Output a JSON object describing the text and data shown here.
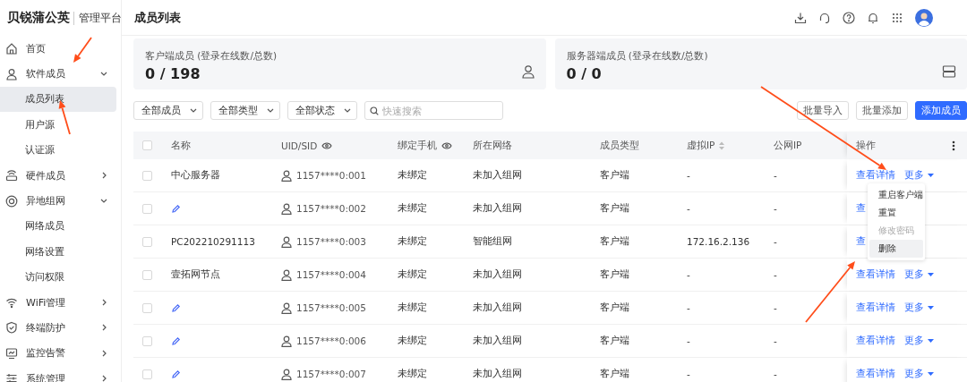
{
  "logo": {
    "brand": "贝锐蒲公英",
    "product": "管理平台"
  },
  "sidebar": {
    "items": [
      {
        "label": "首页",
        "selected": false
      },
      {
        "label": "软件成员",
        "selected": false,
        "expanded": true,
        "children": [
          {
            "label": "成员列表",
            "selected": true
          },
          {
            "label": "用户源",
            "selected": false
          },
          {
            "label": "认证源",
            "selected": false
          }
        ]
      },
      {
        "label": "硬件成员",
        "selected": false,
        "expanded": false
      },
      {
        "label": "异地组网",
        "selected": false,
        "expanded": true,
        "children": [
          {
            "label": "网络成员",
            "selected": false
          },
          {
            "label": "网络设置",
            "selected": false
          },
          {
            "label": "访问权限",
            "selected": false
          }
        ]
      },
      {
        "label": "WiFi管理",
        "selected": false,
        "expanded": false
      },
      {
        "label": "终端防护",
        "selected": false,
        "expanded": false
      },
      {
        "label": "监控告警",
        "selected": false,
        "expanded": false
      },
      {
        "label": "系统管理",
        "selected": false,
        "expanded": false
      }
    ]
  },
  "page_title": "成员列表",
  "stats": [
    {
      "label": "客户端成员 (登录在线数/总数)",
      "value": "0 / 198"
    },
    {
      "label": "服务器端成员 (登录在线数/总数)",
      "value": "0 / 0"
    }
  ],
  "filters": [
    "全部成员",
    "全部类型",
    "全部状态"
  ],
  "search": {
    "placeholder": "快速搜索"
  },
  "buttons": [
    {
      "label": "批量导入",
      "primary": false
    },
    {
      "label": "批量添加",
      "primary": false
    },
    {
      "label": "添加成员",
      "primary": true
    }
  ],
  "table": {
    "all_checked": false,
    "columns": [
      "名称",
      "UID/SID",
      "绑定手机",
      "所在网络",
      "成员类型",
      "虚拟IP",
      "公网IP",
      "操作"
    ],
    "rows": [
      {
        "checked": false,
        "kind": "named",
        "name": "中心服务器",
        "uid": "1157****0:001",
        "phone": "未绑定",
        "network": "未加入组网",
        "type": "客户端",
        "virtual_ip": "-",
        "public_ip": "-",
        "actions": [
          {
            "label": "查看详情",
            "dropdown": false
          },
          {
            "label": "更多",
            "dropdown": true
          }
        ]
      },
      {
        "checked": false,
        "kind": "unnamed",
        "uid": "1157****0:002",
        "phone": "未绑定",
        "network": "未加入组网",
        "type": "客户端",
        "virtual_ip": "-",
        "public_ip": "-",
        "actions": [
          {
            "label": "查",
            "dropdown": false
          }
        ]
      },
      {
        "checked": false,
        "kind": "named",
        "name": "PC202210291113",
        "uid": "1157****0:003",
        "phone": "未绑定",
        "network": "智能组网",
        "type": "客户端",
        "virtual_ip": "172.16.2.136",
        "public_ip": "-",
        "actions": [
          {
            "label": "查",
            "dropdown": false
          }
        ]
      },
      {
        "checked": false,
        "kind": "named",
        "name": "壹拓网节点",
        "uid": "1157****0:004",
        "phone": "未绑定",
        "network": "未加入组网",
        "type": "客户端",
        "virtual_ip": "-",
        "public_ip": "-",
        "actions": [
          {
            "label": "查看详情",
            "dropdown": false
          },
          {
            "label": "更多",
            "dropdown": true
          }
        ]
      },
      {
        "checked": false,
        "kind": "unnamed",
        "uid": "1157****0:005",
        "phone": "未绑定",
        "network": "未加入组网",
        "type": "客户端",
        "virtual_ip": "-",
        "public_ip": "-",
        "actions": [
          {
            "label": "查看详情",
            "dropdown": false
          },
          {
            "label": "更多",
            "dropdown": true
          }
        ]
      },
      {
        "checked": false,
        "kind": "unnamed",
        "uid": "1157****0:006",
        "phone": "未绑定",
        "network": "未加入组网",
        "type": "客户端",
        "virtual_ip": "-",
        "public_ip": "-",
        "actions": [
          {
            "label": "查看详情",
            "dropdown": false
          },
          {
            "label": "更多",
            "dropdown": true
          }
        ]
      },
      {
        "checked": false,
        "kind": "unnamed",
        "uid": "1157****0:007",
        "phone": "未绑定",
        "network": "未加入组网",
        "type": "客户端",
        "virtual_ip": "-",
        "public_ip": "-",
        "actions": [
          {
            "label": "查看详情",
            "dropdown": false
          },
          {
            "label": "更多",
            "dropdown": true
          }
        ]
      }
    ]
  },
  "dropdown_menu": [
    {
      "label": "重启客户端",
      "disabled": false,
      "highlighted": false
    },
    {
      "label": "重置",
      "disabled": false,
      "highlighted": false
    },
    {
      "label": "修改密码",
      "disabled": true,
      "highlighted": false
    },
    {
      "label": "删除",
      "disabled": false,
      "highlighted": true
    }
  ],
  "annotations": [
    {
      "kind": "arrow"
    },
    {
      "kind": "arrow"
    },
    {
      "kind": "arrow"
    },
    {
      "kind": "arrow"
    }
  ]
}
